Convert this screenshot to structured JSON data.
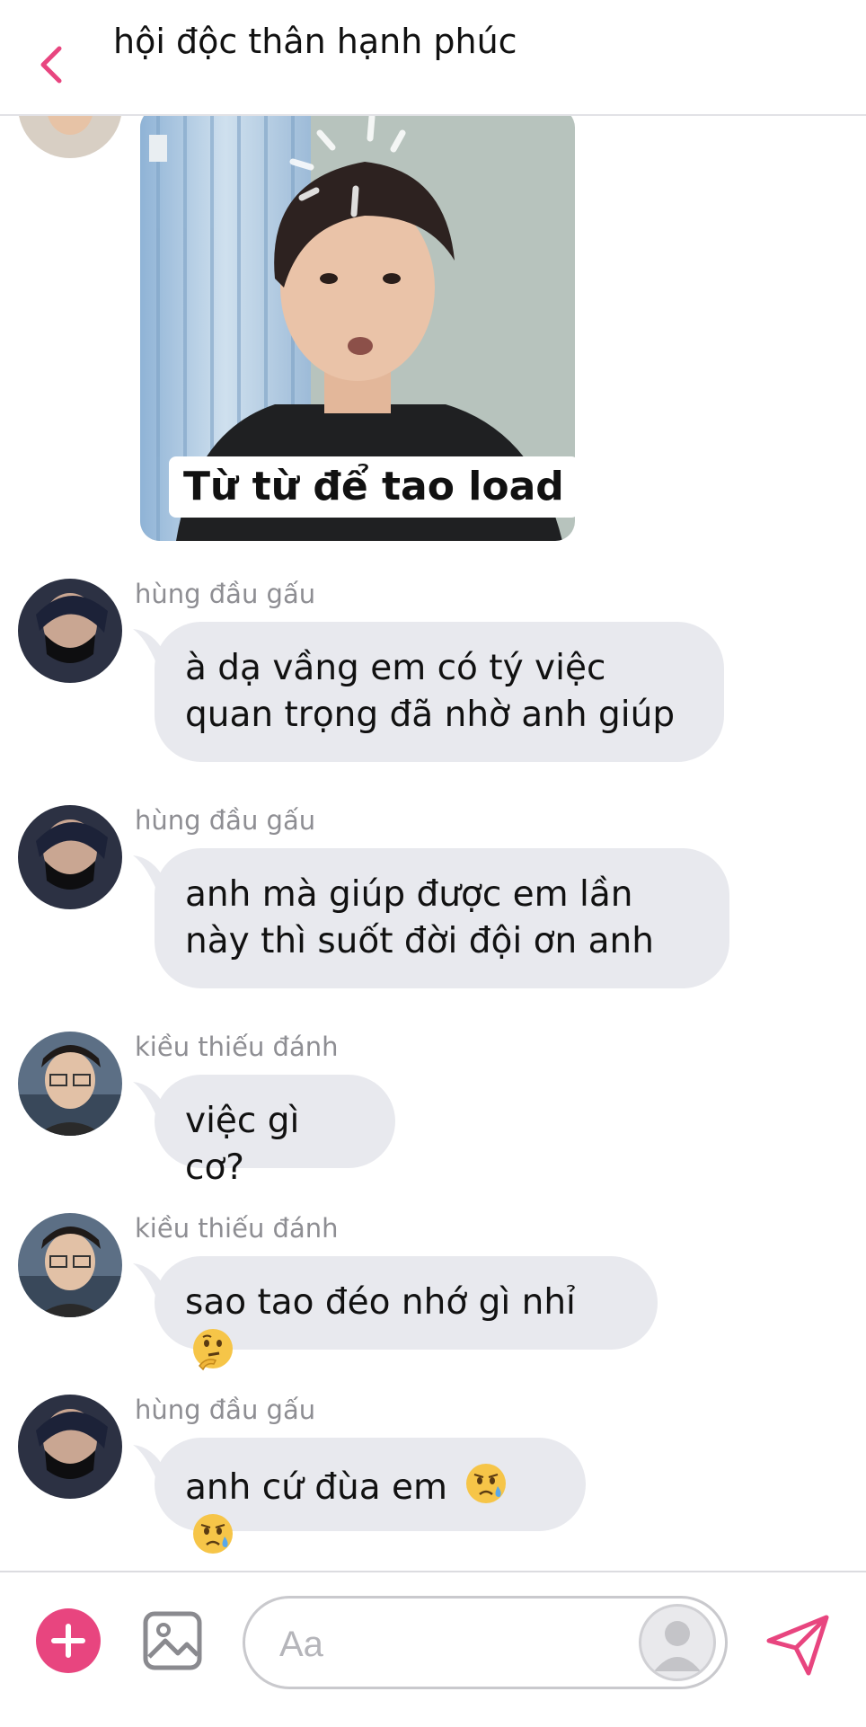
{
  "header": {
    "title": "hội độc thân hạnh phúc",
    "back_icon": "chevron-left-icon",
    "accent_color": "#e8457f"
  },
  "sticker": {
    "caption": "Từ từ để tao load"
  },
  "messages": [
    {
      "sender": "hùng đầu gấu",
      "text": "à dạ vầng em có tý việc quan trọng đã nhờ anh giúp"
    },
    {
      "sender": "hùng đầu gấu",
      "text": "anh mà giúp được em lần này thì suốt đời đội ơn anh"
    },
    {
      "sender": "kiều thiếu đánh",
      "text": "việc gì cơ?"
    },
    {
      "sender": "kiều thiếu đánh",
      "text": "sao tao đéo nhớ gì nhỉ",
      "emoji": [
        "thinking-face-emoji"
      ]
    },
    {
      "sender": "hùng đầu gấu",
      "text": "anh cứ đùa em",
      "emoji": [
        "sad-relieved-face-emoji",
        "sad-relieved-face-emoji"
      ]
    }
  ],
  "input_bar": {
    "placeholder": "Aa",
    "plus_icon": "plus-icon",
    "image_icon": "image-icon",
    "send_icon": "send-icon"
  }
}
